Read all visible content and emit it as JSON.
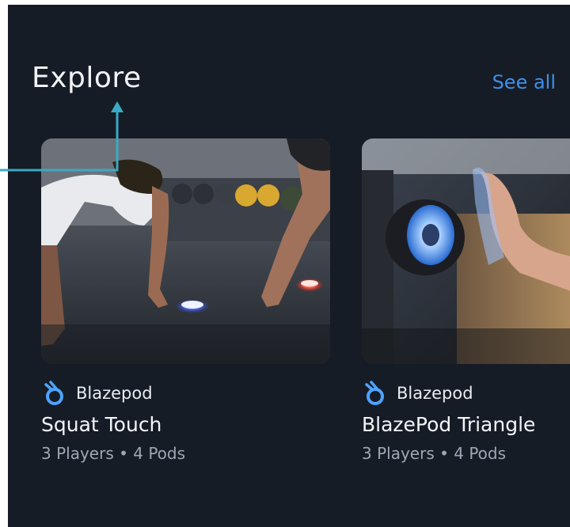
{
  "section": {
    "title": "Explore",
    "see_all_label": "See all"
  },
  "cards": [
    {
      "brand": "Blazepod",
      "title": "Squat Touch",
      "meta": "3 Players • 4 Pods",
      "image": "push-up training with light pods"
    },
    {
      "brand": "Blazepod",
      "title": "BlazePod Triangle",
      "meta": "3 Players • 4 Pods",
      "image": "hand reaching to a glowing light pod"
    }
  ],
  "colors": {
    "background": "#161c26",
    "accent": "#3f8fe8",
    "pointer": "#3aa9c4",
    "text": "#f1f3f6",
    "meta_text": "#9ea7b4"
  },
  "icons": {
    "brand_logo": "blazepod-logo-icon"
  }
}
